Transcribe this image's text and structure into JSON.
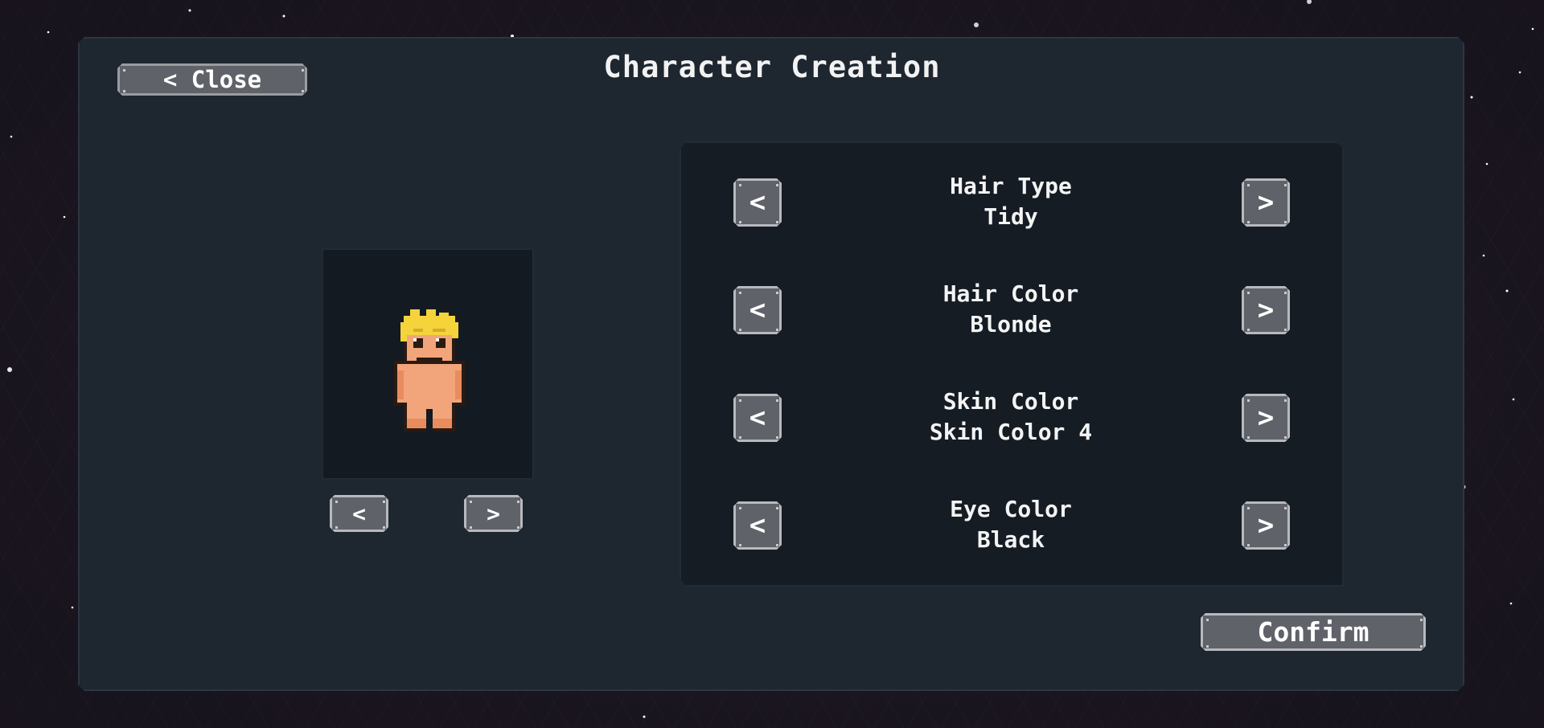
{
  "screen": {
    "title": "Character Creation",
    "close_label": "< Close",
    "confirm_label": "Confirm"
  },
  "preview": {
    "prev_symbol": "<",
    "next_symbol": ">"
  },
  "options": [
    {
      "name": "Hair Type",
      "value": "Tidy",
      "prev_symbol": "<",
      "next_symbol": ">"
    },
    {
      "name": "Hair Color",
      "value": "Blonde",
      "prev_symbol": "<",
      "next_symbol": ">"
    },
    {
      "name": "Skin Color",
      "value": "Skin Color 4",
      "prev_symbol": "<",
      "next_symbol": ">"
    },
    {
      "name": "Eye Color",
      "value": "Black",
      "prev_symbol": "<",
      "next_symbol": ">"
    }
  ],
  "colors": {
    "background": "#1d1822",
    "panel": "#1e2630",
    "button": "#5f6268",
    "hair": "#f5d33b",
    "skin": "#f2a57a",
    "outline": "#2a1a12"
  },
  "icons": {
    "prev": "chevron-left-icon",
    "next": "chevron-right-icon"
  }
}
